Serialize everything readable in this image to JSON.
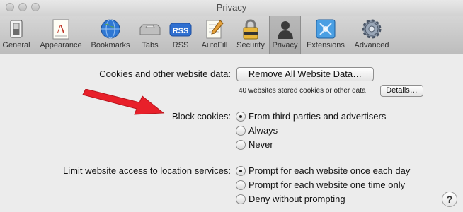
{
  "window": {
    "title": "Privacy"
  },
  "toolbar": {
    "items": [
      {
        "label": "General",
        "icon": "general-switch-icon"
      },
      {
        "label": "Appearance",
        "icon": "appearance-font-icon"
      },
      {
        "label": "Bookmarks",
        "icon": "bookmarks-globe-icon"
      },
      {
        "label": "Tabs",
        "icon": "tabs-icon"
      },
      {
        "label": "RSS",
        "icon": "rss-icon",
        "icon_text": "RSS"
      },
      {
        "label": "AutoFill",
        "icon": "autofill-pen-icon"
      },
      {
        "label": "Security",
        "icon": "security-lock-icon"
      },
      {
        "label": "Privacy",
        "icon": "privacy-person-icon",
        "active": true
      },
      {
        "label": "Extensions",
        "icon": "extensions-puzzle-icon"
      },
      {
        "label": "Advanced",
        "icon": "advanced-gear-icon"
      }
    ]
  },
  "cookies": {
    "label": "Cookies and other website data:",
    "remove_button": "Remove All Website Data…",
    "note": "40 websites stored cookies or other data",
    "details_button": "Details…"
  },
  "block_cookies": {
    "label": "Block cookies:",
    "options": [
      {
        "label": "From third parties and advertisers",
        "checked": true
      },
      {
        "label": "Always",
        "checked": false
      },
      {
        "label": "Never",
        "checked": false
      }
    ]
  },
  "location": {
    "label": "Limit website access to location services:",
    "options": [
      {
        "label": "Prompt for each website once each day",
        "checked": true
      },
      {
        "label": "Prompt for each website one time only",
        "checked": false
      },
      {
        "label": "Deny without prompting",
        "checked": false
      }
    ]
  },
  "help": {
    "label": "?"
  },
  "colors": {
    "annotation_arrow": "#e8202a",
    "rss_badge": "#2f6fd0"
  }
}
